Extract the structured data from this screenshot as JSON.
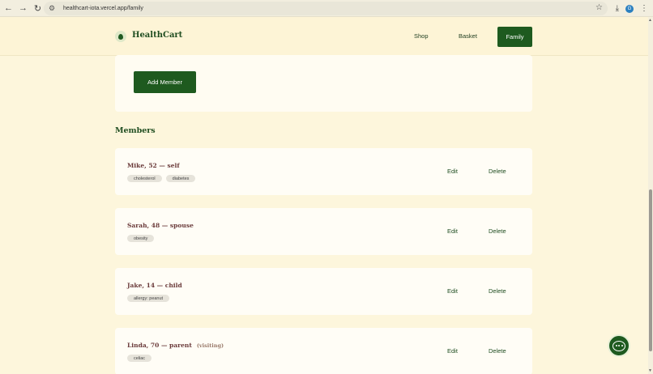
{
  "browser": {
    "url": "healthcart-iota.vercel.app/family",
    "profile_initial": "G"
  },
  "header": {
    "brand": "HealthCart",
    "nav": {
      "shop": "Shop",
      "basket": "Basket",
      "family": "Family"
    }
  },
  "form": {
    "add_member_label": "Add Member"
  },
  "members_heading": "Members",
  "members": [
    {
      "name": "Mike, 52 — self",
      "note": "",
      "tags": [
        "cholesterol",
        "diabetes"
      ],
      "edit": "Edit",
      "delete": "Delete"
    },
    {
      "name": "Sarah, 48 — spouse",
      "note": "",
      "tags": [
        "obesity"
      ],
      "edit": "Edit",
      "delete": "Delete"
    },
    {
      "name": "Jake, 14 — child",
      "note": "",
      "tags": [
        "allergy: peanut"
      ],
      "edit": "Edit",
      "delete": "Delete"
    },
    {
      "name": "Linda, 70 — parent",
      "note": "(visiting)",
      "tags": [
        "celiac"
      ],
      "edit": "Edit",
      "delete": "Delete"
    }
  ],
  "colors": {
    "page_bg": "#fdf6dc",
    "brand_green": "#1e5a1f",
    "member_name": "#6a3a3a"
  },
  "icons": {
    "back": "arrow-left-icon",
    "forward": "arrow-right-icon",
    "reload": "reload-icon",
    "bookmark": "star-icon",
    "download": "download-icon",
    "chat": "chat-bubble-icon"
  }
}
